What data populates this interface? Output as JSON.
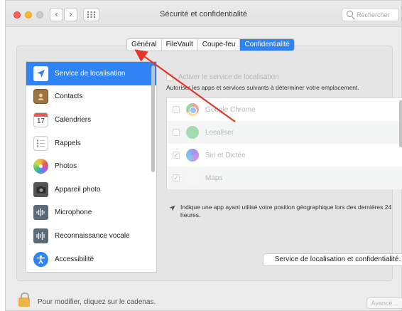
{
  "window": {
    "title": "Sécurité et confidentialité",
    "search_placeholder": "Rechercher"
  },
  "tabs": [
    {
      "label": "Général",
      "active": false
    },
    {
      "label": "FileVault",
      "active": false
    },
    {
      "label": "Coupe-feu",
      "active": false
    },
    {
      "label": "Confidentialité",
      "active": true
    }
  ],
  "sidebar": {
    "items": [
      {
        "label": "Service de localisation",
        "icon": "location-arrow-icon",
        "selected": true
      },
      {
        "label": "Contacts",
        "icon": "contacts-book-icon",
        "selected": false
      },
      {
        "label": "Calendriers",
        "icon": "calendar-icon",
        "selected": false
      },
      {
        "label": "Rappels",
        "icon": "reminders-icon",
        "selected": false
      },
      {
        "label": "Photos",
        "icon": "photos-icon",
        "selected": false
      },
      {
        "label": "Appareil photo",
        "icon": "camera-icon",
        "selected": false
      },
      {
        "label": "Microphone",
        "icon": "microphone-icon",
        "selected": false
      },
      {
        "label": "Reconnaissance vocale",
        "icon": "speech-recognition-icon",
        "selected": false
      },
      {
        "label": "Accessibilité",
        "icon": "accessibility-icon",
        "selected": false
      }
    ],
    "calendar_day": "17"
  },
  "location": {
    "enable_label": "Activer le service de localisation",
    "enabled": false,
    "description": "Autoriser les apps et services suivants à déterminer votre emplacement.",
    "apps": [
      {
        "name": "Google Chrome",
        "checked": false,
        "icon": "chrome-icon"
      },
      {
        "name": "Localiser",
        "checked": false,
        "icon": "find-my-icon"
      },
      {
        "name": "Siri et Dictée",
        "checked": true,
        "icon": "siri-icon"
      },
      {
        "name": "Maps",
        "checked": true,
        "icon": "maps-icon"
      }
    ],
    "note": "Indique une app ayant utilisé votre position géographique lors des dernières 24 heures.",
    "privacy_button": "Service de localisation et confidentialité…"
  },
  "footer": {
    "lock_text": "Pour modifier, cliquez sur le cadenas.",
    "advanced_button": "Avancé…"
  },
  "colors": {
    "accent": "#2f83f4",
    "annotation_arrow": "#e2362b"
  }
}
